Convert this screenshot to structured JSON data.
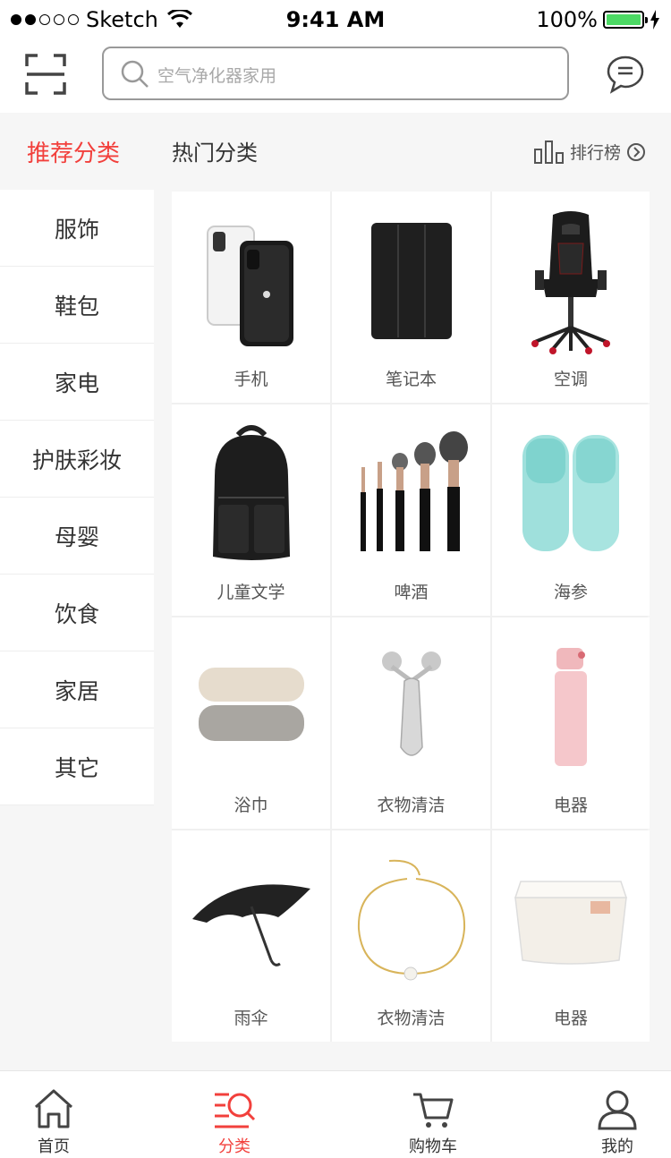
{
  "status_bar": {
    "carrier": "Sketch",
    "time": "9:41 AM",
    "battery": "100%"
  },
  "header": {
    "search_placeholder": "空气净化器家用"
  },
  "category_header": {
    "recommended": "推荐分类",
    "hot": "热门分类",
    "ranking": "排行榜"
  },
  "sidebar": {
    "items": [
      {
        "label": "服饰"
      },
      {
        "label": "鞋包"
      },
      {
        "label": "家电"
      },
      {
        "label": "护肤彩妆"
      },
      {
        "label": "母婴"
      },
      {
        "label": "饮食"
      },
      {
        "label": "家居"
      },
      {
        "label": "其它"
      }
    ]
  },
  "grid": {
    "items": [
      {
        "label": "手机",
        "icon": "phone-case-image"
      },
      {
        "label": "笔记本",
        "icon": "tablet-case-image"
      },
      {
        "label": "空调",
        "icon": "gaming-chair-image"
      },
      {
        "label": "儿童文学",
        "icon": "backpack-image"
      },
      {
        "label": "啤酒",
        "icon": "makeup-brushes-image"
      },
      {
        "label": "海参",
        "icon": "slippers-image"
      },
      {
        "label": "浴巾",
        "icon": "towels-image"
      },
      {
        "label": "衣物清洁",
        "icon": "face-roller-image"
      },
      {
        "label": "电器",
        "icon": "thermos-image"
      },
      {
        "label": "雨伞",
        "icon": "umbrella-image"
      },
      {
        "label": "衣物清洁",
        "icon": "necklace-image"
      },
      {
        "label": "电器",
        "icon": "storage-box-image"
      }
    ]
  },
  "tabbar": {
    "items": [
      {
        "label": "首页",
        "icon": "home-icon"
      },
      {
        "label": "分类",
        "icon": "category-icon"
      },
      {
        "label": "购物车",
        "icon": "cart-icon"
      },
      {
        "label": "我的",
        "icon": "user-icon"
      }
    ],
    "active_color": "#f2403c"
  },
  "colors": {
    "accent": "#f2403c",
    "battery": "#4cd964"
  }
}
